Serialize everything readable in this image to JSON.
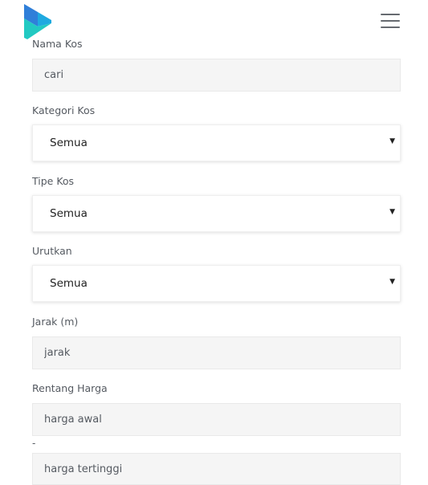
{
  "header": {
    "logo_icon": "brand-logo-icon",
    "menu_icon": "hamburger-menu-icon",
    "brand_colors": [
      "#2f7fd9",
      "#22c9c2"
    ]
  },
  "form": {
    "nama_kos": {
      "label": "Nama Kos",
      "placeholder": "cari"
    },
    "kategori_kos": {
      "label": "Kategori Kos",
      "value": "Semua"
    },
    "tipe_kos": {
      "label": "Tipe Kos",
      "value": "Semua"
    },
    "urutkan": {
      "label": "Urutkan",
      "value": "Semua"
    },
    "jarak": {
      "label": "Jarak (m)",
      "placeholder": "jarak"
    },
    "rentang_harga": {
      "label": "Rentang Harga",
      "min_placeholder": "harga awal",
      "separator": "-",
      "max_placeholder": "harga tertinggi"
    }
  }
}
